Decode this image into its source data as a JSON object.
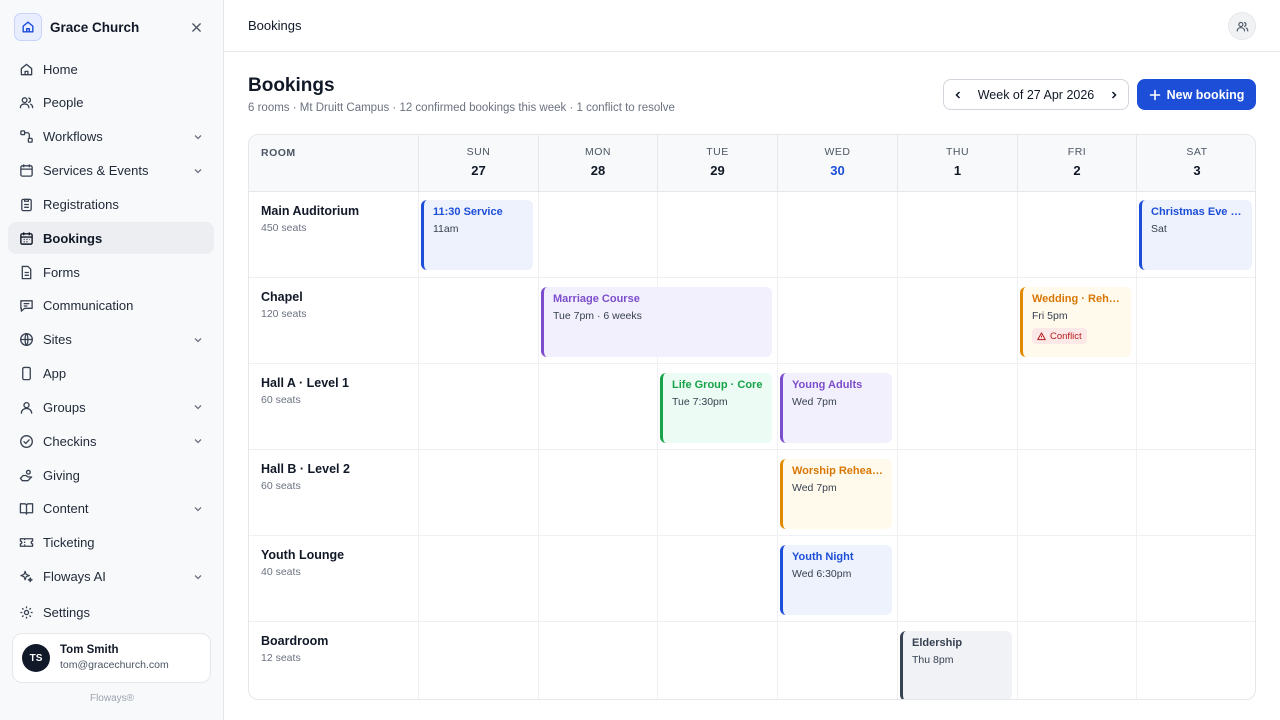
{
  "org": {
    "name": "Grace Church"
  },
  "nav": {
    "home": "Home",
    "people": "People",
    "workflows": "Workflows",
    "services": "Services & Events",
    "registrations": "Registrations",
    "bookings": "Bookings",
    "forms": "Forms",
    "communication": "Communication",
    "sites": "Sites",
    "app": "App",
    "groups": "Groups",
    "checkins": "Checkins",
    "giving": "Giving",
    "content": "Content",
    "ticketing": "Ticketing",
    "ai": "Floways AI",
    "settings": "Settings"
  },
  "user": {
    "initials": "TS",
    "name": "Tom Smith",
    "email": "tom@gracechurch.com"
  },
  "brand": "Floways®",
  "topbar": {
    "breadcrumb": "Bookings"
  },
  "header": {
    "title": "Bookings",
    "subtitle": "6 rooms · Mt Druitt Campus · 12 confirmed bookings this week · 1 conflict to resolve",
    "week_label": "Week of 27 Apr 2026",
    "new_booking": "New booking"
  },
  "grid": {
    "room_header": "ROOM",
    "days": [
      {
        "dow": "SUN",
        "num": "27"
      },
      {
        "dow": "MON",
        "num": "28"
      },
      {
        "dow": "TUE",
        "num": "29"
      },
      {
        "dow": "WED",
        "num": "30",
        "today": true
      },
      {
        "dow": "THU",
        "num": "1"
      },
      {
        "dow": "FRI",
        "num": "2"
      },
      {
        "dow": "SAT",
        "num": "3"
      }
    ],
    "rooms": [
      {
        "name": "Main Auditorium",
        "seats": "450 seats"
      },
      {
        "name": "Chapel",
        "seats": "120 seats"
      },
      {
        "name": "Hall A · Level 1",
        "seats": "60 seats"
      },
      {
        "name": "Hall B · Level 2",
        "seats": "60 seats"
      },
      {
        "name": "Youth Lounge",
        "seats": "40 seats"
      },
      {
        "name": "Boardroom",
        "seats": "12 seats"
      }
    ]
  },
  "events": {
    "service_1130": {
      "title": "11:30 Service",
      "time": "11am"
    },
    "christmas_eve": {
      "title": "Christmas Eve Service",
      "time": "Sat"
    },
    "marriage_course": {
      "title": "Marriage Course",
      "time": "Tue 7pm · 6 weeks"
    },
    "wedding": {
      "title": "Wedding · Rehearsal",
      "time": "Fri 5pm",
      "badge": "Conflict"
    },
    "life_group": {
      "title": "Life Group · Core",
      "time": "Tue 7:30pm"
    },
    "young_adults": {
      "title": "Young Adults",
      "time": "Wed 7pm"
    },
    "worship": {
      "title": "Worship Rehearsal",
      "time": "Wed 7pm"
    },
    "youth_night": {
      "title": "Youth Night",
      "time": "Wed 6:30pm"
    },
    "eldership": {
      "title": "Eldership",
      "time": "Thu 8pm"
    }
  },
  "colors": {
    "accent": "#1d4ed8",
    "purple": "#7c4dcc",
    "green": "#16a34a",
    "orange": "#e08a00",
    "conflict": "#b91c1c"
  }
}
